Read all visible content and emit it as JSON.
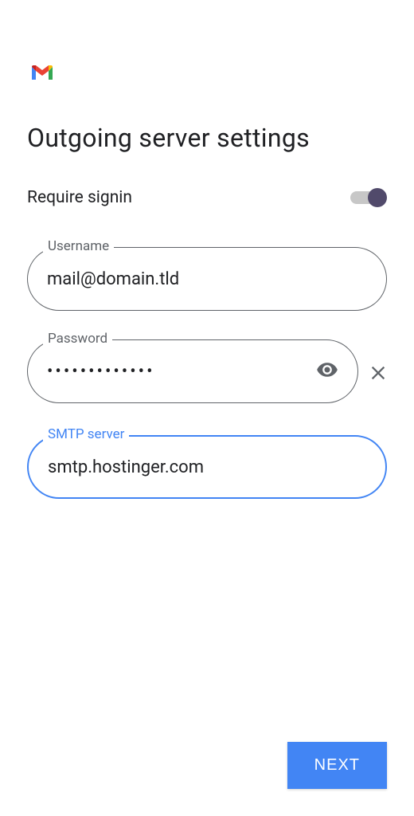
{
  "header": {
    "title": "Outgoing server settings"
  },
  "toggle": {
    "label": "Require signin",
    "state": "on"
  },
  "fields": {
    "username": {
      "label": "Username",
      "value": "mail@domain.tld"
    },
    "password": {
      "label": "Password",
      "value": "•••••••••••••"
    },
    "smtp": {
      "label": "SMTP server",
      "value": "smtp.hostinger.com"
    }
  },
  "actions": {
    "next": "NEXT"
  }
}
